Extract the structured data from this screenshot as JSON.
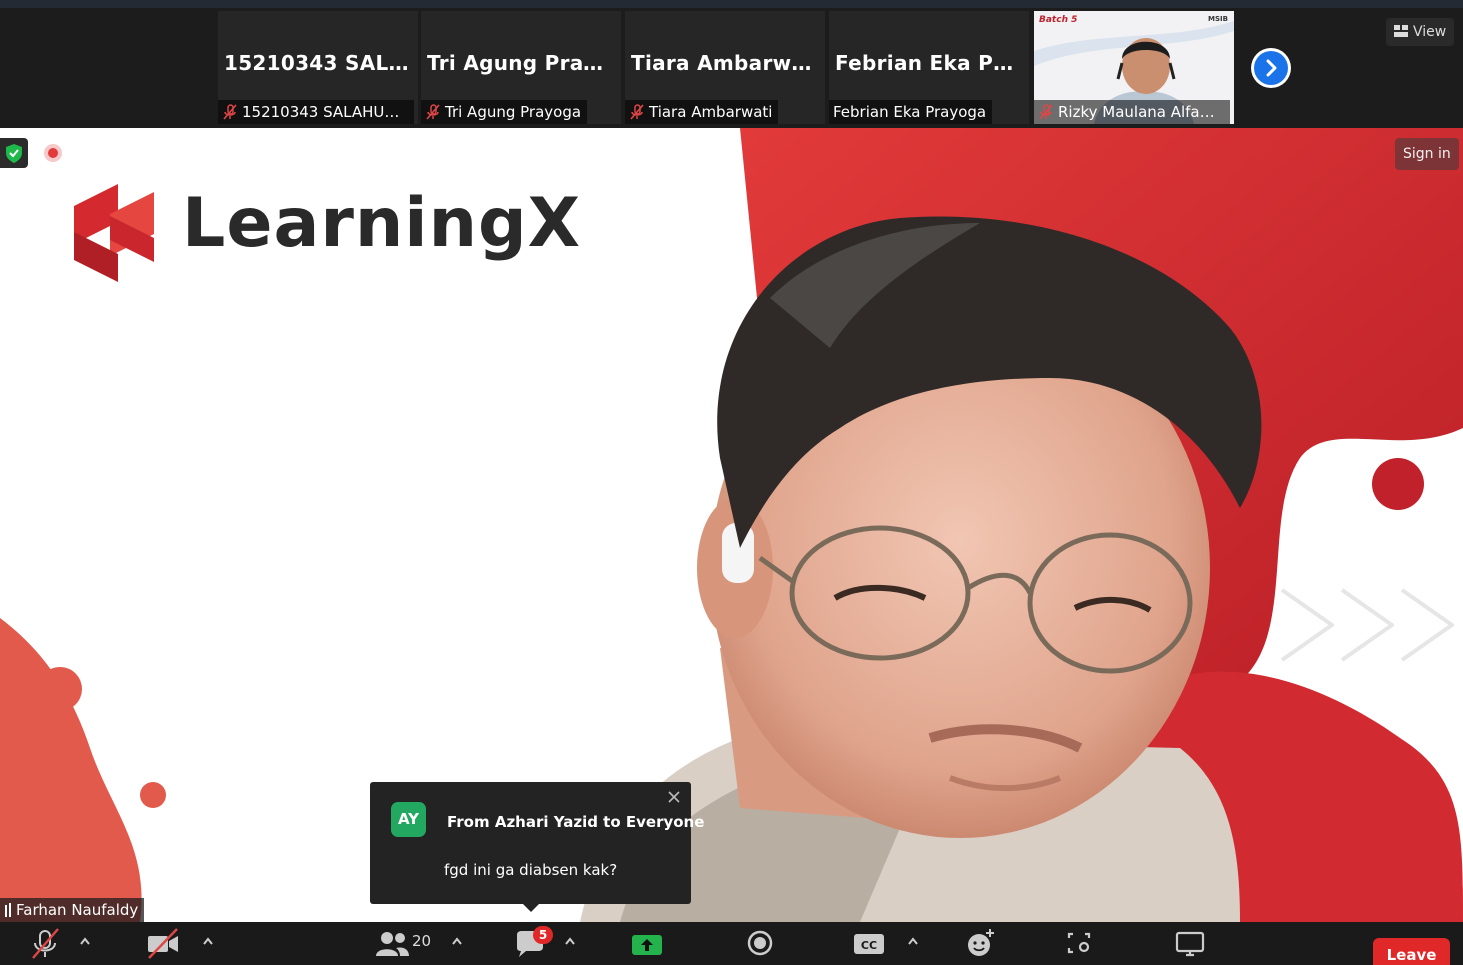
{
  "participants": [
    {
      "display_name": "15210343  SALA...",
      "label": "15210343 SALAHUDI...",
      "muted": true
    },
    {
      "display_name": "Tri Agung Prayo...",
      "label": "Tri Agung Prayoga",
      "muted": true
    },
    {
      "display_name": "Tiara Ambarwati",
      "label": "Tiara Ambarwati",
      "muted": true
    },
    {
      "display_name": "Febrian Eka Pra...",
      "label": "Febrian Eka Prayoga",
      "muted": false
    },
    {
      "label": "Rizky Maulana Alfauzan",
      "muted": true,
      "video": true,
      "overlay_text": "Batch 5",
      "overlay_brand": "MSIB"
    }
  ],
  "view_label": "View",
  "sign_in_label": "Sign in",
  "brand_text": "LearningX",
  "speaker_name": "Farhan Naufaldy",
  "chat_popup": {
    "avatar_initials": "AY",
    "from": "From Azhari Yazid to Everyone",
    "message": "fgd ini ga diabsen kak?"
  },
  "toolbar": {
    "participants_count": "20",
    "chat_badge": "5",
    "leave_label": "Leave"
  },
  "colors": {
    "accent_blue": "#1a73e8",
    "leave_red": "#e02828",
    "share_green": "#23b24c",
    "avatar_green": "#23a861",
    "brand_red": "#d42a2f"
  }
}
